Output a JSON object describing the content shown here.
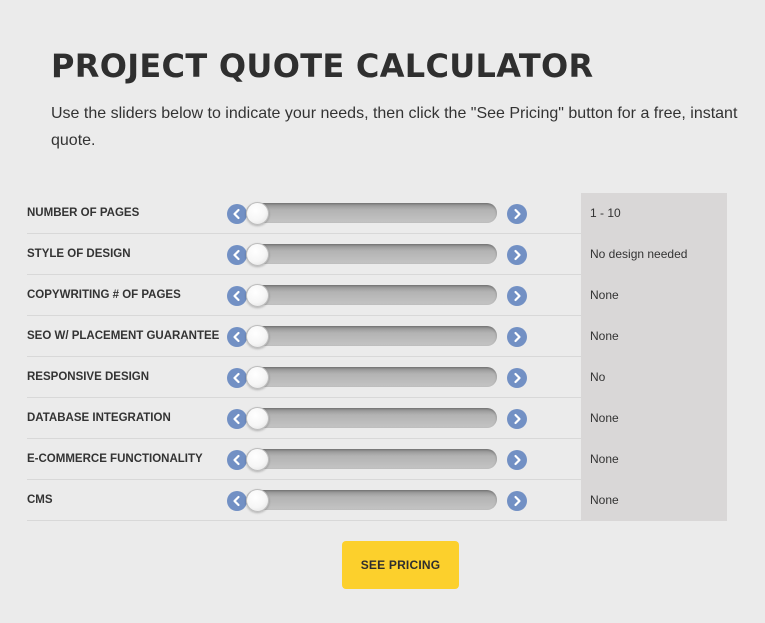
{
  "page": {
    "title": "PROJECT QUOTE CALCULATOR",
    "subtitle": "Use the sliders below to indicate your needs, then click the \"See Pricing\" button for a free, instant quote."
  },
  "calculator": {
    "rows": [
      {
        "label": "NUMBER OF PAGES",
        "value": "1 - 10",
        "slider_level": 0
      },
      {
        "label": "STYLE OF DESIGN",
        "value": "No design needed",
        "slider_level": 0
      },
      {
        "label": "COPYWRITING # OF PAGES",
        "value": "None",
        "slider_level": 0
      },
      {
        "label": "SEO W/ PLACEMENT GUARANTEE",
        "value": "None",
        "slider_level": 0
      },
      {
        "label": "RESPONSIVE DESIGN",
        "value": "No",
        "slider_level": 0
      },
      {
        "label": "DATABASE INTEGRATION",
        "value": "None",
        "slider_level": 0
      },
      {
        "label": "E-COMMERCE FUNCTIONALITY",
        "value": "None",
        "slider_level": 0
      },
      {
        "label": "CMS",
        "value": "None",
        "slider_level": 0
      }
    ],
    "icons": {
      "decrease": "chevron-left-icon",
      "increase": "chevron-right-icon"
    },
    "colors": {
      "arrow_button": "#7290c4",
      "value_panel": "#d9d7d7"
    }
  },
  "actions": {
    "see_pricing_label": "SEE PRICING",
    "see_pricing_color": "#fcd02c"
  }
}
